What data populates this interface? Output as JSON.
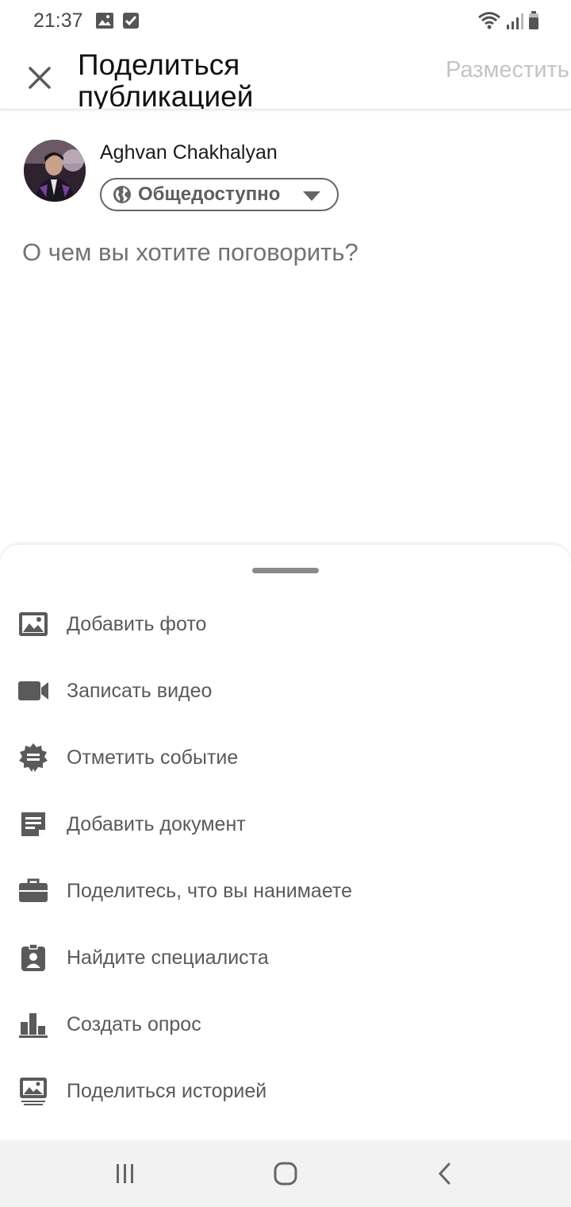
{
  "status_bar": {
    "time": "21:37",
    "icons": [
      "image-notification-icon",
      "checkbox-notification-icon",
      "wifi-icon",
      "signal-icon",
      "battery-icon"
    ]
  },
  "header": {
    "title": "Поделиться публикацией",
    "post_label": "Разместить",
    "close_icon": "close-icon"
  },
  "author": {
    "name": "Aghvan Chakhalyan",
    "visibility_label": "Общедоступно",
    "visibility_icon": "globe-icon"
  },
  "composer": {
    "placeholder": "О чем вы хотите поговорить?"
  },
  "sheet": {
    "items": [
      {
        "label": "Добавить фото",
        "icon": "photo-icon"
      },
      {
        "label": "Записать видео",
        "icon": "video-camera-icon"
      },
      {
        "label": "Отметить событие",
        "icon": "celebrate-badge-icon"
      },
      {
        "label": "Добавить документ",
        "icon": "document-icon"
      },
      {
        "label": "Поделитесь, что вы нанимаете",
        "icon": "briefcase-icon"
      },
      {
        "label": "Найдите специалиста",
        "icon": "id-badge-icon"
      },
      {
        "label": "Создать опрос",
        "icon": "poll-icon"
      },
      {
        "label": "Поделиться историей",
        "icon": "story-icon"
      }
    ]
  },
  "navbar": {
    "icons": [
      "recent-apps-icon",
      "home-icon",
      "back-icon"
    ]
  },
  "colors": {
    "icon_gray": "#5a5a5a",
    "disabled_text": "#c4c4c4",
    "nav_background": "#f2f2f2"
  }
}
